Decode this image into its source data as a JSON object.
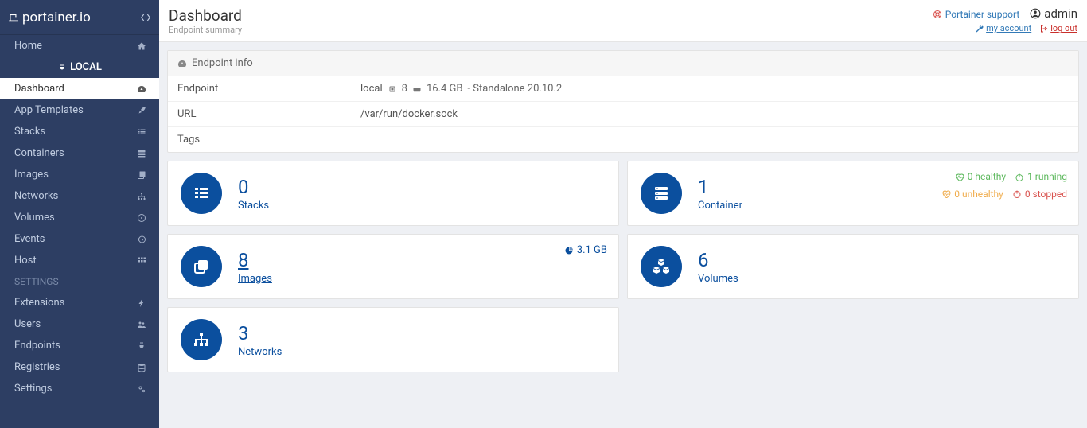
{
  "brand": "portainer.io",
  "sidebar": {
    "home": "Home",
    "group_label": "LOCAL",
    "items": [
      {
        "label": "Dashboard",
        "icon": "tachometer",
        "active": true
      },
      {
        "label": "App Templates",
        "icon": "rocket"
      },
      {
        "label": "Stacks",
        "icon": "list"
      },
      {
        "label": "Containers",
        "icon": "server"
      },
      {
        "label": "Images",
        "icon": "clone"
      },
      {
        "label": "Networks",
        "icon": "sitemap"
      },
      {
        "label": "Volumes",
        "icon": "hdd"
      },
      {
        "label": "Events",
        "icon": "history"
      },
      {
        "label": "Host",
        "icon": "th"
      }
    ],
    "section": "SETTINGS",
    "settings": [
      {
        "label": "Extensions",
        "icon": "bolt"
      },
      {
        "label": "Users",
        "icon": "users"
      },
      {
        "label": "Endpoints",
        "icon": "plug"
      },
      {
        "label": "Registries",
        "icon": "database"
      },
      {
        "label": "Settings",
        "icon": "cogs"
      }
    ]
  },
  "topbar": {
    "title": "Dashboard",
    "subtitle": "Endpoint summary",
    "support": "Portainer support",
    "user": "admin",
    "my_account": "my account",
    "logout": "log out"
  },
  "endpoint_panel": {
    "header": "Endpoint info",
    "rows": {
      "endpoint_key": "Endpoint",
      "endpoint_name": "local",
      "cpu_count": "8",
      "memory": "16.4 GB",
      "mode": "- Standalone 20.10.2",
      "url_key": "URL",
      "url_val": "/var/run/docker.sock",
      "tags_key": "Tags",
      "tags_val": ""
    }
  },
  "cards": {
    "stacks": {
      "count": "0",
      "label": "Stacks"
    },
    "containers": {
      "count": "1",
      "label": "Container",
      "healthy": "0 healthy",
      "unhealthy": "0 unhealthy",
      "running": "1 running",
      "stopped": "0 stopped"
    },
    "images": {
      "count": "8",
      "label": "Images",
      "size": "3.1 GB"
    },
    "volumes": {
      "count": "6",
      "label": "Volumes"
    },
    "networks": {
      "count": "3",
      "label": "Networks"
    }
  }
}
